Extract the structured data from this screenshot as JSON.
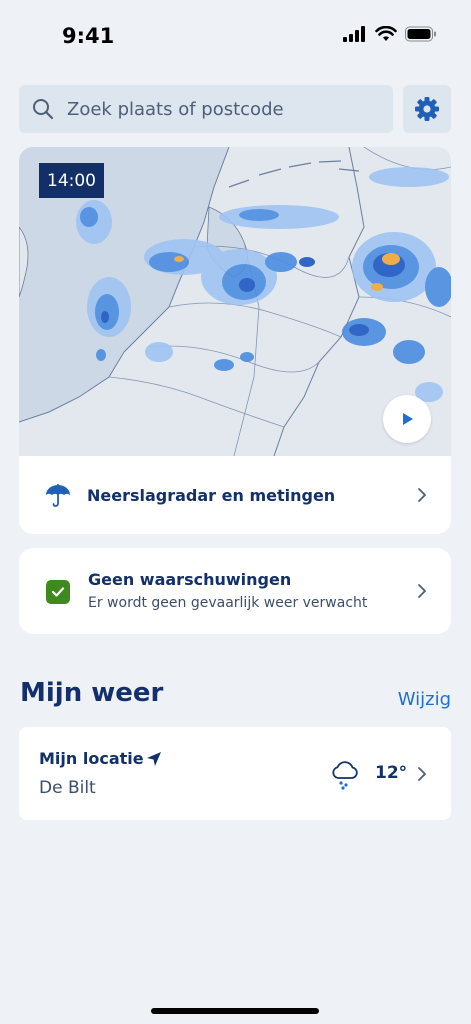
{
  "status_bar": {
    "time": "9:41"
  },
  "search": {
    "placeholder": "Zoek plaats of postcode"
  },
  "radar": {
    "time_label": "14:00",
    "title": "Neerslagradar en metingen"
  },
  "warnings": {
    "title": "Geen waarschuwingen",
    "subtitle": "Er wordt geen gevaarlijk weer verwacht"
  },
  "my_weather": {
    "title": "Mijn weer",
    "edit_label": "Wijzig",
    "location": {
      "name": "Mijn locatie",
      "city": "De Bilt",
      "temperature": "12°",
      "condition_icon": "cloud-rain-icon"
    }
  },
  "colors": {
    "navy": "#13306b",
    "accent_blue": "#1f6fd1",
    "ok_green": "#3f8a1f",
    "background": "#eef2f7"
  }
}
